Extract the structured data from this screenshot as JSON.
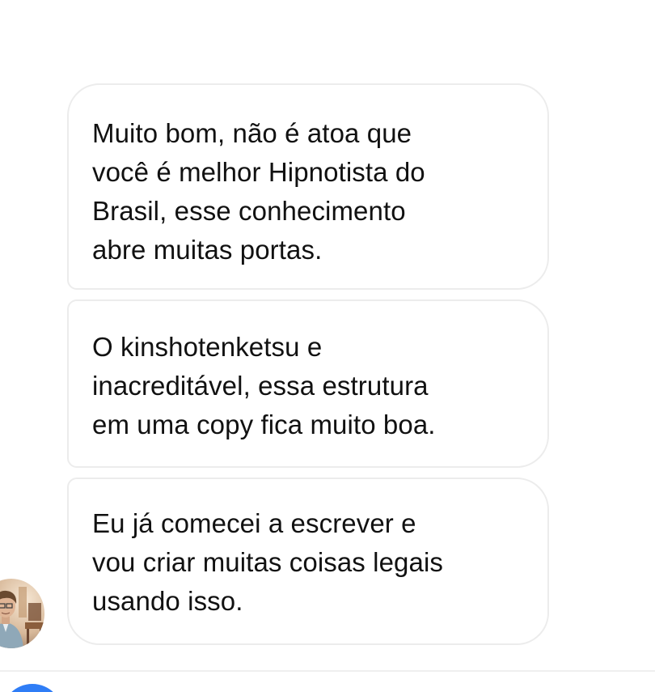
{
  "messages": [
    {
      "lines": [
        "Muito bom, não é atoa que",
        "você é melhor Hipnotista do",
        "Brasil, esse conhecimento",
        "abre muitas portas."
      ]
    },
    {
      "lines": [
        "O kinshotenketsu e",
        "inacreditável, essa estrutura",
        "em uma copy fica muito boa."
      ]
    },
    {
      "lines": [
        "Eu já comecei a escrever e",
        "vou criar muitas coisas legais",
        "usando isso."
      ]
    }
  ],
  "colors": {
    "bubble_border": "#ececec",
    "text": "#111111",
    "accent": "#2f7df6"
  },
  "icons": {
    "avatar": "sender-avatar"
  }
}
